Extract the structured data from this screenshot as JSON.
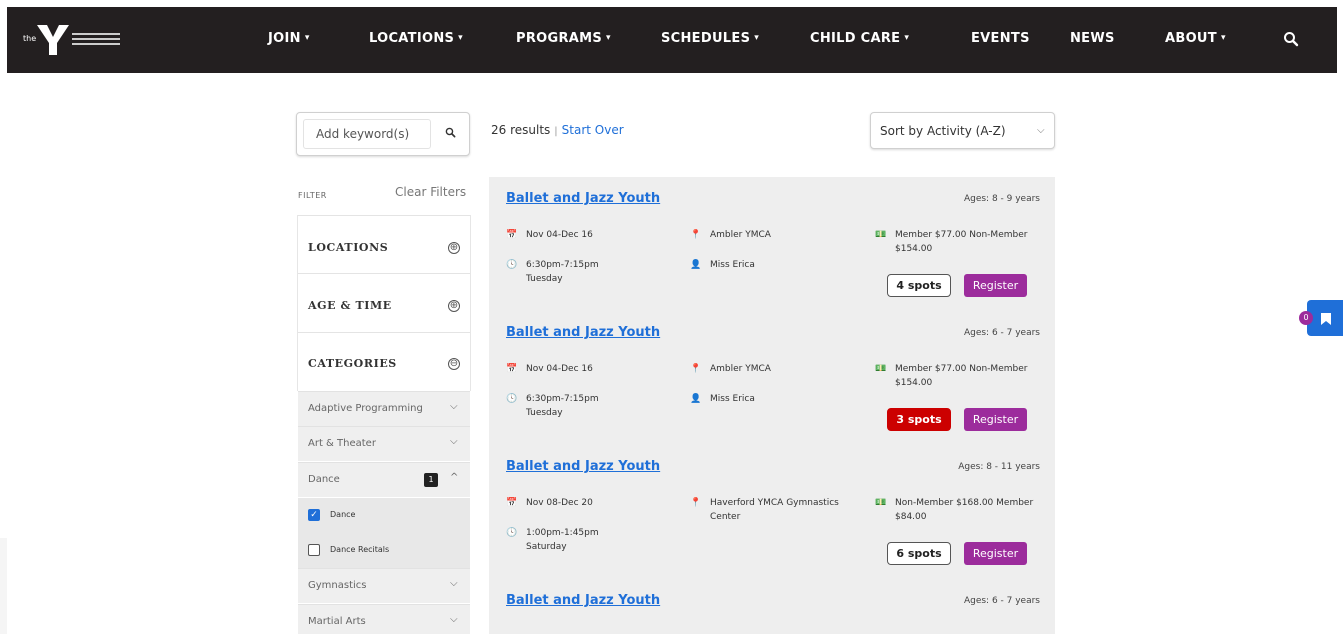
{
  "nav": {
    "logo_prefix": "the",
    "items": [
      {
        "label": "JOIN",
        "caret": "▾"
      },
      {
        "label": "LOCATIONS",
        "caret": "▾"
      },
      {
        "label": "PROGRAMS",
        "caret": "▾"
      },
      {
        "label": "SCHEDULES",
        "caret": "▾"
      },
      {
        "label": "CHILD CARE",
        "caret": "▾"
      },
      {
        "label": "EVENTS",
        "caret": ""
      },
      {
        "label": "NEWS",
        "caret": ""
      },
      {
        "label": "ABOUT",
        "caret": "▾"
      }
    ],
    "search_icon": "search-icon"
  },
  "search": {
    "placeholder": "Add keyword(s)"
  },
  "filter": {
    "label": "FILTER",
    "clear": "Clear Filters",
    "sections": [
      {
        "title": "LOCATIONS",
        "icon": "⊕"
      },
      {
        "title": "AGE & TIME",
        "icon": "⊕"
      },
      {
        "title": "CATEGORIES",
        "icon": "⊖"
      }
    ],
    "categories": [
      {
        "label": "Adaptive Programming",
        "chevron": "⌵"
      },
      {
        "label": "Art & Theater",
        "chevron": "⌵"
      },
      {
        "label": "Dance",
        "chevron": "^",
        "badge": "1"
      },
      {
        "label": "Gymnastics",
        "chevron": "⌵"
      },
      {
        "label": "Martial Arts",
        "chevron": "⌵"
      }
    ],
    "dance_sub": [
      {
        "label": "Dance",
        "checked": true
      },
      {
        "label": "Dance Recitals",
        "checked": false
      }
    ]
  },
  "results": {
    "count": "26 results",
    "separator": "|",
    "start_over": "Start Over"
  },
  "sort": {
    "label": "Sort by Activity (A-Z)"
  },
  "cards": [
    {
      "title": "Ballet and Jazz Youth",
      "ages": "Ages:  8 - 9 years",
      "dates": "Nov 04-Dec 16",
      "time": "6:30pm-7:15pm",
      "day": "Tuesday",
      "location": "Ambler YMCA",
      "instructor": "Miss Erica",
      "price": "Member $77.00 Non-Member $154.00",
      "spots": "4 spots",
      "spots_status": "available",
      "register": "Register"
    },
    {
      "title": "Ballet and Jazz Youth",
      "ages": "Ages:  6 - 7 years",
      "dates": "Nov 04-Dec 16",
      "time": "6:30pm-7:15pm",
      "day": "Tuesday",
      "location": "Ambler YMCA",
      "instructor": "Miss Erica",
      "price": "Member $77.00 Non-Member $154.00",
      "spots": "3 spots",
      "spots_status": "low",
      "register": "Register"
    },
    {
      "title": "Ballet and Jazz Youth",
      "ages": "Ages:  8 - 11 years",
      "dates": "Nov 08-Dec 20",
      "time": "1:00pm-1:45pm",
      "day": "Saturday",
      "location": "Haverford YMCA Gymnastics Center",
      "instructor": "",
      "price": "Non-Member $168.00 Member $84.00",
      "spots": "6 spots",
      "spots_status": "available",
      "register": "Register"
    },
    {
      "title": "Ballet and Jazz Youth",
      "ages": "Ages:  6 - 7 years"
    }
  ],
  "bookmark": {
    "count": "0"
  },
  "colors": {
    "nav_bg": "#231f20",
    "link": "#1f6fd8",
    "register": "#9c2c9c",
    "spots_low": "#cc0000"
  }
}
